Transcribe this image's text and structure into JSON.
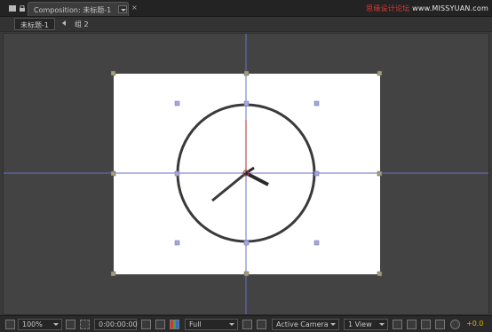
{
  "tabbar": {
    "composition_tab": "Composition: 未标题-1",
    "close_glyph": "×",
    "watermark_prefix": "思缘设计论坛 ",
    "watermark_site": "www.MISSYUAN.com"
  },
  "breadcrumb": {
    "comp_name": "未标题-1",
    "group_name": "组 2"
  },
  "toolbar": {
    "zoom": "100%",
    "timecode": "0:00:00:00",
    "resolution": "Full",
    "camera": "Active Camera",
    "view_layout": "1 View",
    "exposure": "+0.0"
  },
  "colors": {
    "viewport_bg": "#434343",
    "solid": "#ffffff",
    "guide": "#6e6ec8",
    "clock_stroke": "#3a3a3a",
    "second_hand": "#b05050",
    "exposure": "#e2b000"
  }
}
